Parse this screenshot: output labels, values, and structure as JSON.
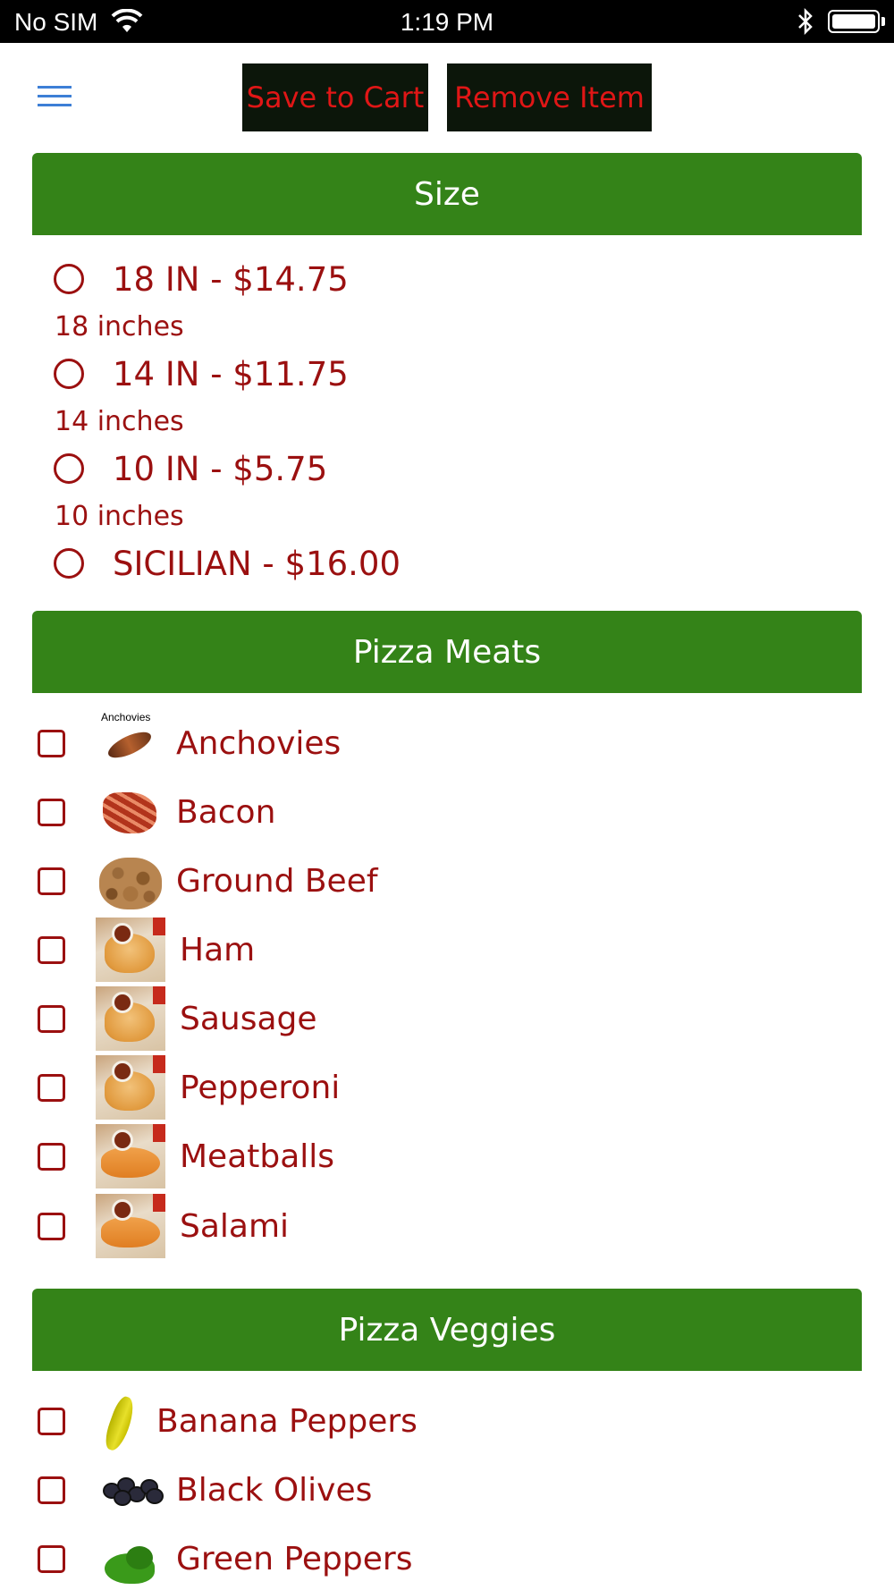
{
  "status_bar": {
    "carrier": "No SIM",
    "time": "1:19 PM"
  },
  "toolbar": {
    "save_label": "Save to Cart",
    "remove_label": "Remove Item"
  },
  "colors": {
    "section_header_bg": "#348318",
    "text_accent": "#9b1010",
    "button_bg": "#0c160a",
    "button_text": "#e01616",
    "menu_icon": "#3d7fd6"
  },
  "size_section": {
    "title": "Size",
    "options": [
      {
        "label": "18 IN - $14.75",
        "description": "18 inches"
      },
      {
        "label": "14 IN - $11.75",
        "description": "14 inches"
      },
      {
        "label": "10 IN - $5.75",
        "description": "10 inches"
      },
      {
        "label": "SICILIAN - $16.00",
        "description": ""
      }
    ]
  },
  "meats_section": {
    "title": "Pizza Meats",
    "items": [
      {
        "label": "Anchovies",
        "thumb_caption": "Anchovies"
      },
      {
        "label": "Bacon"
      },
      {
        "label": "Ground Beef"
      },
      {
        "label": "Ham"
      },
      {
        "label": "Sausage"
      },
      {
        "label": "Pepperoni"
      },
      {
        "label": "Meatballs"
      },
      {
        "label": "Salami"
      }
    ]
  },
  "veggies_section": {
    "title": "Pizza Veggies",
    "items": [
      {
        "label": "Banana Peppers"
      },
      {
        "label": "Black Olives"
      },
      {
        "label": "Green Peppers"
      }
    ]
  }
}
